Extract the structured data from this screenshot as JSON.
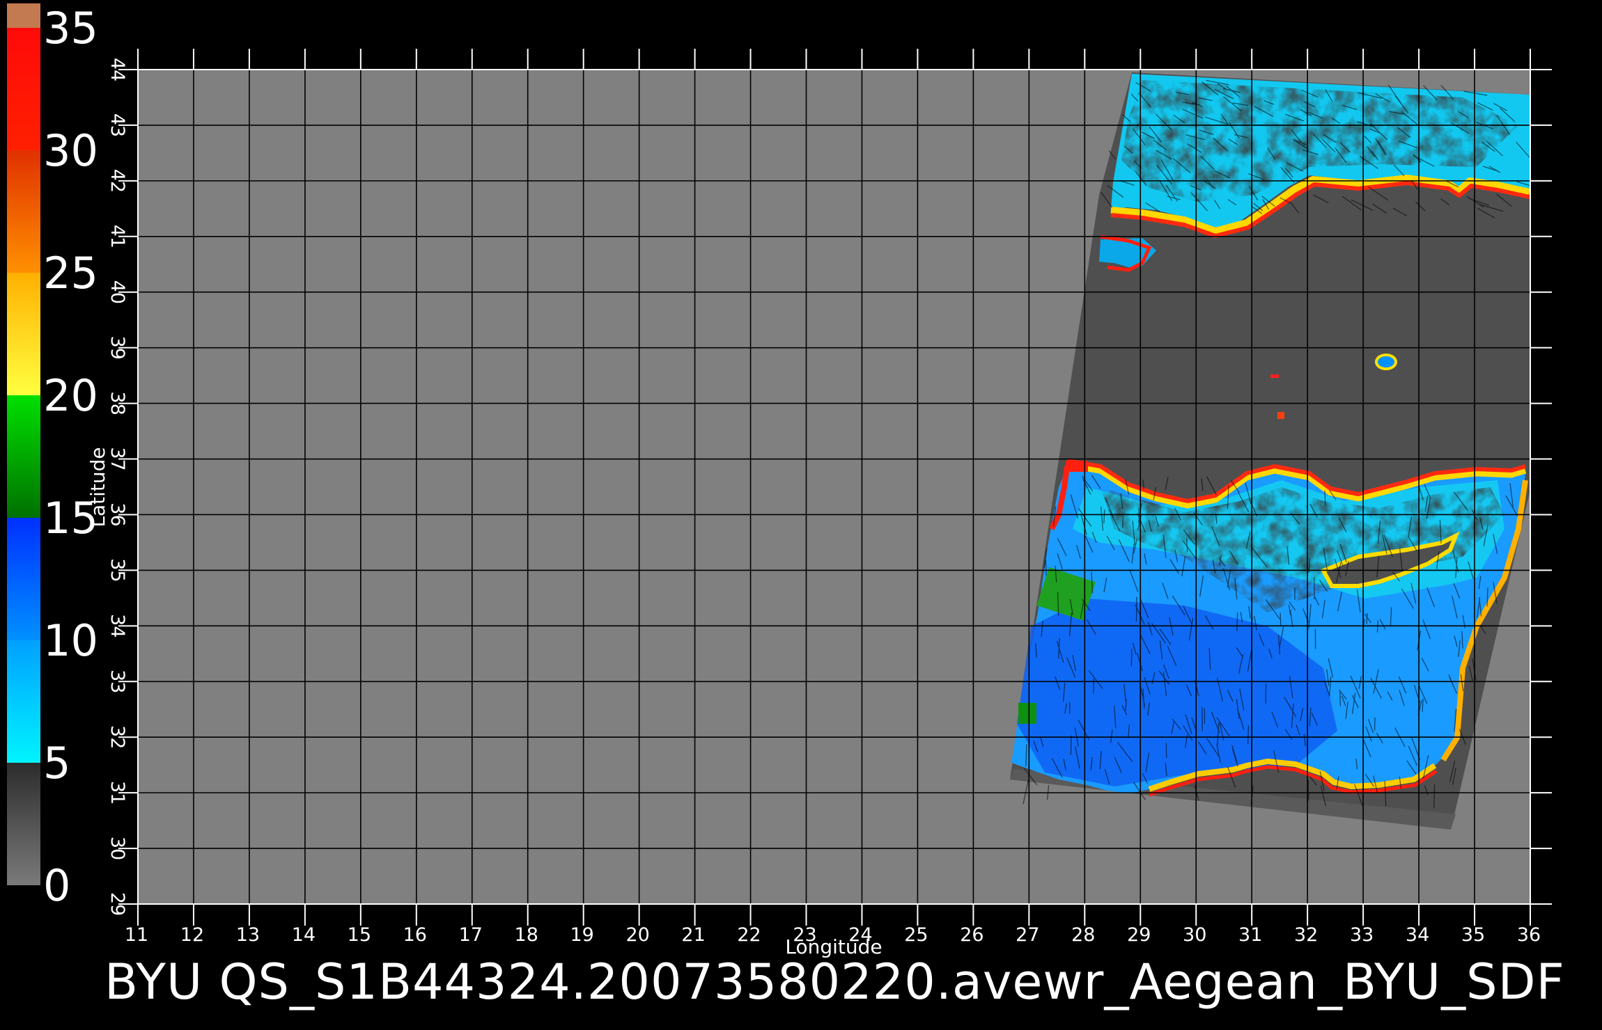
{
  "colorbar": {
    "labels": [
      "35",
      "30",
      "25",
      "20",
      "15",
      "10",
      "5",
      "0"
    ],
    "values": [
      35,
      30,
      25,
      20,
      15,
      10,
      5,
      0
    ],
    "range": [
      0,
      35
    ],
    "stops": [
      {
        "from": 0,
        "to": 5,
        "colors": [
          "#7a7a7a",
          "#2c2c2c"
        ]
      },
      {
        "from": 5,
        "to": 10,
        "colors": [
          "#00f4ff",
          "#00a0ff"
        ]
      },
      {
        "from": 10,
        "to": 15,
        "colors": [
          "#0090ff",
          "#0030ff"
        ]
      },
      {
        "from": 15,
        "to": 20,
        "colors": [
          "#007000",
          "#00e000"
        ]
      },
      {
        "from": 20,
        "to": 25,
        "colors": [
          "#ffff40",
          "#ffb000"
        ]
      },
      {
        "from": 25,
        "to": 30,
        "colors": [
          "#ff9000",
          "#e03000"
        ]
      },
      {
        "from": 30,
        "to": 35,
        "colors": [
          "#ff2000",
          "#ff0a0a"
        ]
      },
      {
        "from": 35,
        "to": 36,
        "colors": [
          "#c47a50",
          "#c47a50"
        ]
      }
    ]
  },
  "map": {
    "lon_range": [
      11,
      36
    ],
    "lat_range": [
      29,
      44
    ],
    "xticks": [
      "11",
      "12",
      "13",
      "14",
      "15",
      "16",
      "17",
      "18",
      "19",
      "20",
      "21",
      "22",
      "23",
      "24",
      "25",
      "26",
      "27",
      "28",
      "29",
      "30",
      "31",
      "32",
      "33",
      "34",
      "35",
      "36"
    ],
    "yticks": [
      "29",
      "30",
      "31",
      "32",
      "33",
      "34",
      "35",
      "36",
      "37",
      "38",
      "39",
      "40",
      "41",
      "42",
      "43",
      "44"
    ],
    "xlabel": "Longitude",
    "ylabel": "Latitude",
    "background_color": "#808080",
    "swath_color": "#4f4f4f",
    "grid_color": "#000000",
    "grid": true
  },
  "caption": "BYU  QS_S1B44324.20073580220.avewr_Aegean_BYU_SDF"
}
